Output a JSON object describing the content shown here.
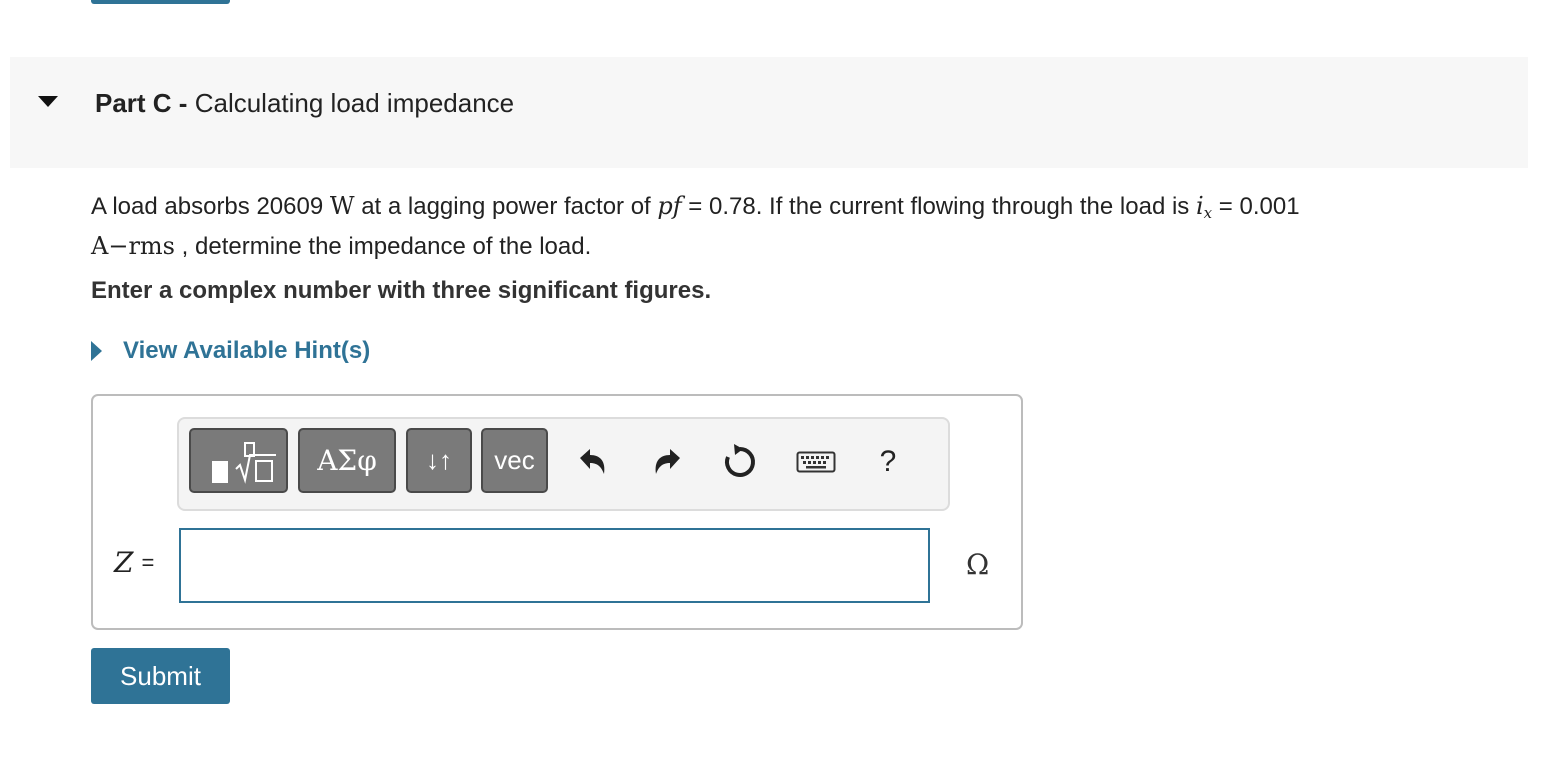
{
  "part": {
    "label": "Part C -",
    "title": "Calculating load impedance"
  },
  "problem": {
    "intro": "A load absorbs 20609",
    "power_unit": "W",
    "text_pf": "at a lagging power factor of",
    "pf_symbol": "pf",
    "pf_value": " = 0.78. If the current flowing through the load is",
    "current_symbol": "i",
    "current_subscript": "x",
    "current_value": " = 0.001",
    "current_unit": "A−rms",
    "closing": ", determine the impedance of the load."
  },
  "instruction": "Enter a complex number with three significant figures.",
  "hints": {
    "label": "View Available Hint(s)"
  },
  "toolbar": {
    "templates_icon": "templates-icon",
    "greek_label": "ΑΣφ",
    "arrows_label": "↓↑",
    "vec_label": "vec",
    "undo_icon": "undo-icon",
    "redo_icon": "redo-icon",
    "reset_icon": "reset-icon",
    "keyboard_icon": "keyboard-icon",
    "help_label": "?"
  },
  "answer": {
    "variable": "Z",
    "equals": "=",
    "value": "",
    "unit": "Ω"
  },
  "submit_label": "Submit",
  "colors": {
    "accent": "#2f7396",
    "header_bg": "#f7f7f7",
    "tool_button": "#7a7a7a"
  }
}
